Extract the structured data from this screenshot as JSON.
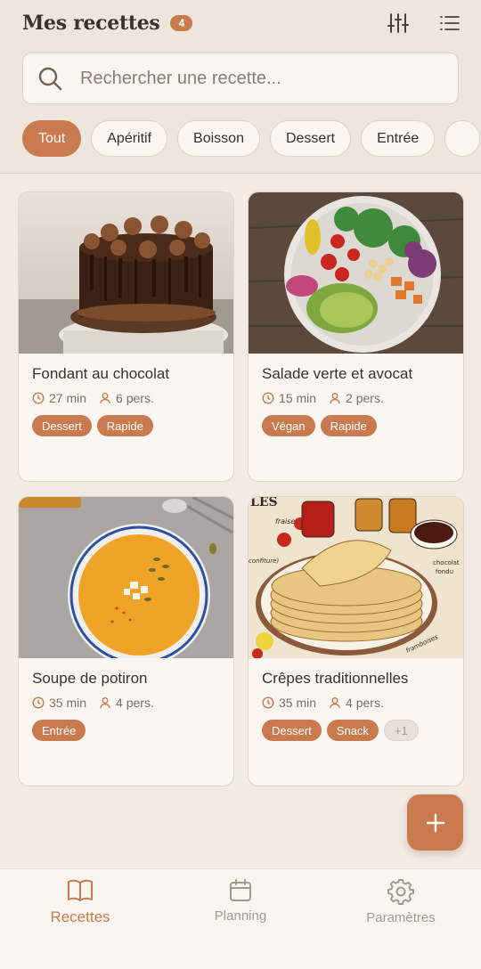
{
  "header": {
    "title": "Mes recettes",
    "count": "4",
    "filter_icon": "sliders-icon",
    "list_icon": "list-icon"
  },
  "search": {
    "placeholder": "Rechercher une recette...",
    "value": ""
  },
  "filters": {
    "chips": [
      "Tout",
      "Apéritif",
      "Boisson",
      "Dessert",
      "Entrée",
      ""
    ],
    "active": "Tout"
  },
  "recipes": [
    {
      "title": "Fondant au chocolat",
      "time": "27 min",
      "servings": "6 pers.",
      "tags": [
        "Dessert",
        "Rapide"
      ],
      "extra": ""
    },
    {
      "title": "Salade verte et avocat",
      "time": "15 min",
      "servings": "2 pers.",
      "tags": [
        "Végan",
        "Rapide"
      ],
      "extra": ""
    },
    {
      "title": "Soupe de potiron",
      "time": "35 min",
      "servings": "4 pers.",
      "tags": [
        "Entrée"
      ],
      "extra": ""
    },
    {
      "title": "Crêpes traditionnelles",
      "time": "35 min",
      "servings": "4 pers.",
      "tags": [
        "Dessert",
        "Snack"
      ],
      "extra": "+1"
    }
  ],
  "image_labels": {
    "crepes_top": "LES",
    "fraises": "fraises",
    "confiture": "confiture)",
    "chocolat": "chocolat",
    "fondu": "fondu",
    "framboise": "framboises"
  },
  "nav": {
    "items": [
      {
        "label": "Recettes",
        "icon": "book-icon"
      },
      {
        "label": "Planning",
        "icon": "calendar-icon"
      },
      {
        "label": "Paramètres",
        "icon": "gear-icon"
      }
    ],
    "active": "Recettes"
  },
  "colors": {
    "accent": "#c97a4e",
    "background": "#f1ebe3",
    "card": "#faf7f3"
  }
}
